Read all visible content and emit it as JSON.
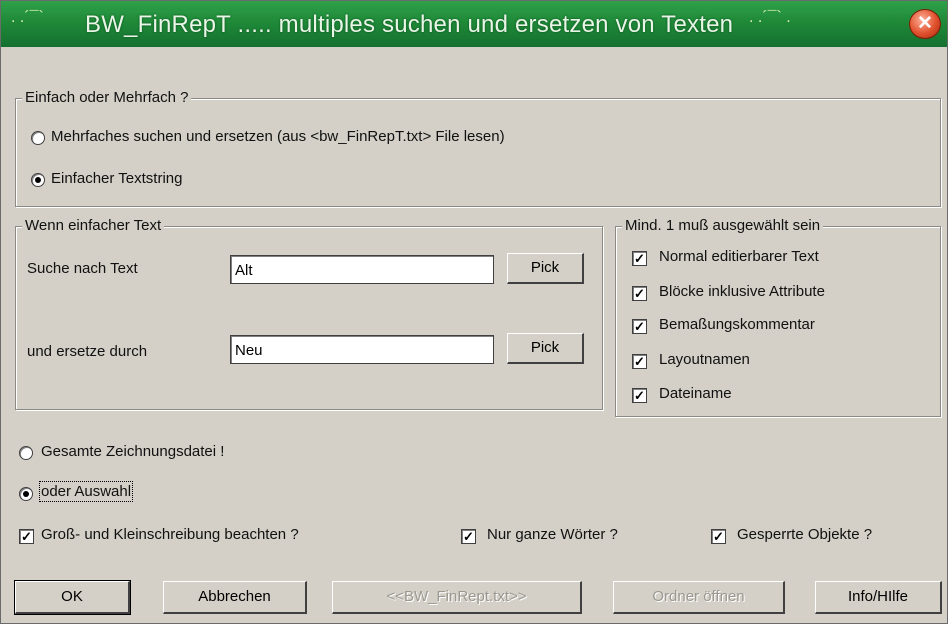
{
  "window": {
    "title": "BW_FinRepT ..... multiples suchen und ersetzen von Texten"
  },
  "mode_group": {
    "legend": "Einfach oder Mehrfach ?",
    "option_multi": "Mehrfaches suchen und ersetzen (aus <bw_FinRepT.txt> File lesen)",
    "option_single": "Einfacher Textstring",
    "selected": "single"
  },
  "text_group": {
    "legend": "Wenn einfacher Text",
    "search_label": "Suche nach Text",
    "search_value": "Alt",
    "replace_label": "und ersetze durch",
    "replace_value": "Neu",
    "pick_label": "Pick"
  },
  "options_group": {
    "legend": "Mind. 1 muß ausgewählt sein",
    "items": [
      {
        "label": "Normal editierbarer Text",
        "checked": true
      },
      {
        "label": "Blöcke inklusive Attribute",
        "checked": true
      },
      {
        "label": "Bemaßungskommentar",
        "checked": true
      },
      {
        "label": "Layoutnamen",
        "checked": true
      },
      {
        "label": "Dateiname",
        "checked": true
      }
    ]
  },
  "scope": {
    "option_all": "Gesamte Zeichnungsdatei !",
    "option_selection": "oder Auswahl",
    "selected": "selection"
  },
  "flags": {
    "case_sensitive": "Groß- und Kleinschreibung beachten ?",
    "whole_words": "Nur ganze Wörter ?",
    "locked_objects": "Gesperrte Objekte ?"
  },
  "buttons": {
    "ok": "OK",
    "cancel": "Abbrechen",
    "file": "<<BW_FinRept.txt>>",
    "open_folder": "Ordner öffnen",
    "info": "Info/HIlfe"
  },
  "colors": {
    "titlebar": "#1f8a38",
    "dialog_bg": "#d4d0c8",
    "close_button": "#e0502c"
  }
}
